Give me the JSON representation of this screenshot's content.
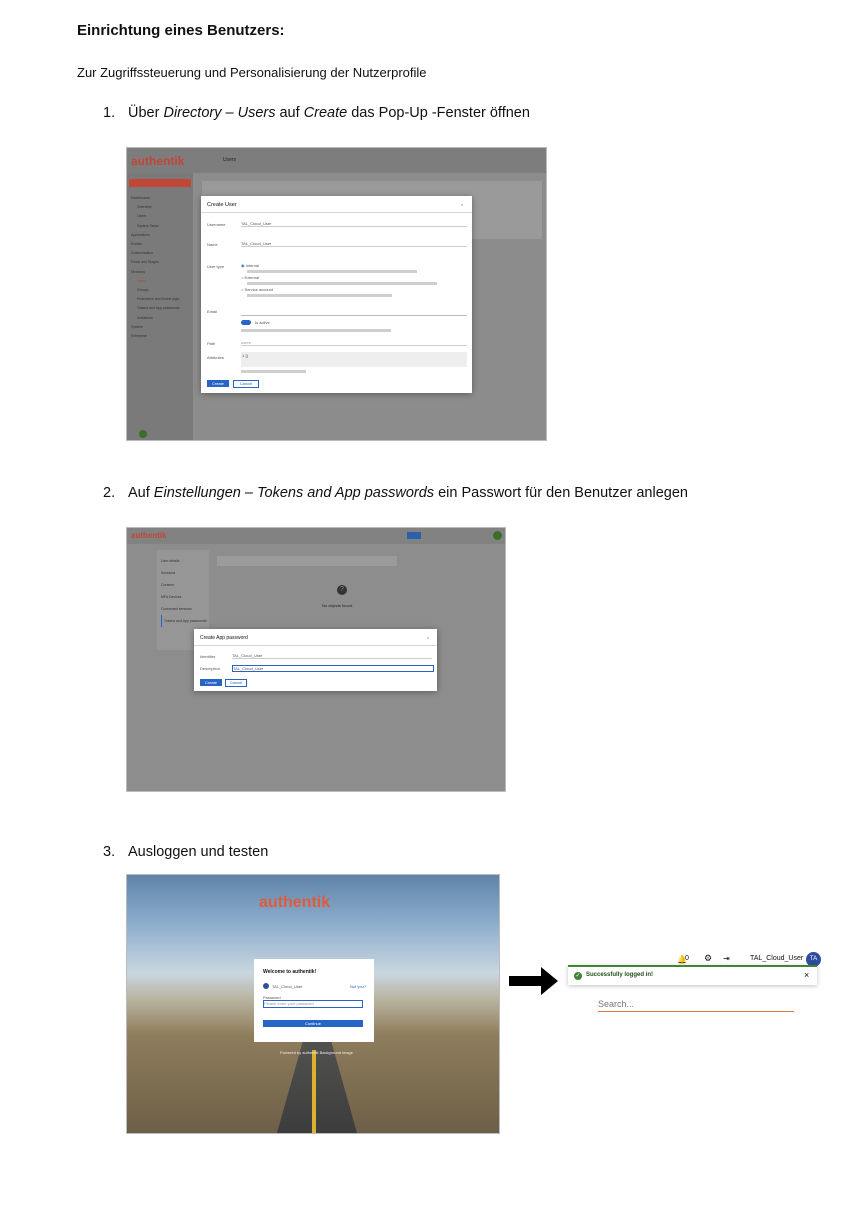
{
  "heading": "Einrichtung eines Benutzers:",
  "intro": "Zur Zugriffssteuerung und Personalisierung der Nutzerprofile",
  "steps": [
    {
      "num": "1.",
      "pre": "Über ",
      "i1": "Directory – Users",
      "mid": " auf ",
      "i2": "Create",
      "post": " das Pop-Up -Fenster öffnen"
    },
    {
      "num": "2.",
      "pre": "Auf ",
      "i1": "Einstellungen – Tokens and App passwords",
      "post": " ein Passwort für den Benutzer anlegen"
    },
    {
      "num": "3.",
      "text": "Ausloggen und testen"
    }
  ],
  "shot1": {
    "brand": "authentik",
    "page": "Users",
    "modal_title": "Create User",
    "username_label": "Username",
    "username_value": "TAL_Cloud_User",
    "name_label": "Name",
    "name_value": "TAL_Cloud_User",
    "usertype_label": "User type",
    "opt_internal": "Internal",
    "opt_external": "External",
    "opt_service": "Service account",
    "email_label": "Email",
    "active_label": "Is active",
    "path_label": "Path",
    "path_value": "users",
    "attributes_label": "Attributes",
    "attributes_value": "1  {}",
    "create_btn": "Create",
    "cancel_btn": "Cancel",
    "sidebar_items": [
      "Dashboards",
      "Overview",
      "Users",
      "System Tasks",
      "Applications",
      "Events",
      "Customisation",
      "Flows and Stages",
      "Directory",
      "Users",
      "Groups",
      "Federation and Social login",
      "Tokens and App passwords",
      "Invitations",
      "System",
      "Enterprise"
    ]
  },
  "shot2": {
    "brand": "authentik",
    "modal_title": "Create App password",
    "identifier_label": "Identifier",
    "identifier_value": "TAL_Cloud_User",
    "description_label": "Description",
    "description_value": "TAL_Cloud_User",
    "create_btn": "Create",
    "cancel_btn": "Cancel",
    "empty_text": "No objects found.",
    "side_items": [
      "User details",
      "Sessions",
      "Consent",
      "MFA Devices",
      "Connected services",
      "Tokens and App passwords"
    ]
  },
  "shot3": {
    "brand": "authentik",
    "welcome": "Welcome to authentik!",
    "user": "TAL_Cloud_User",
    "not_you": "Not you?",
    "password_label": "Password",
    "password_placeholder": "Please enter your password",
    "continue_btn": "Continue",
    "footer": "Powered by authentik    Background image"
  },
  "shot4": {
    "notif_count": "0",
    "username": "TAL_Cloud_User",
    "avatar": "TA",
    "toast": "Successfully logged in!",
    "close": "×",
    "search_placeholder": "Search..."
  },
  "colors": {
    "brand": "#e04a3a",
    "primary": "#2664c6",
    "success": "#3e8635"
  }
}
